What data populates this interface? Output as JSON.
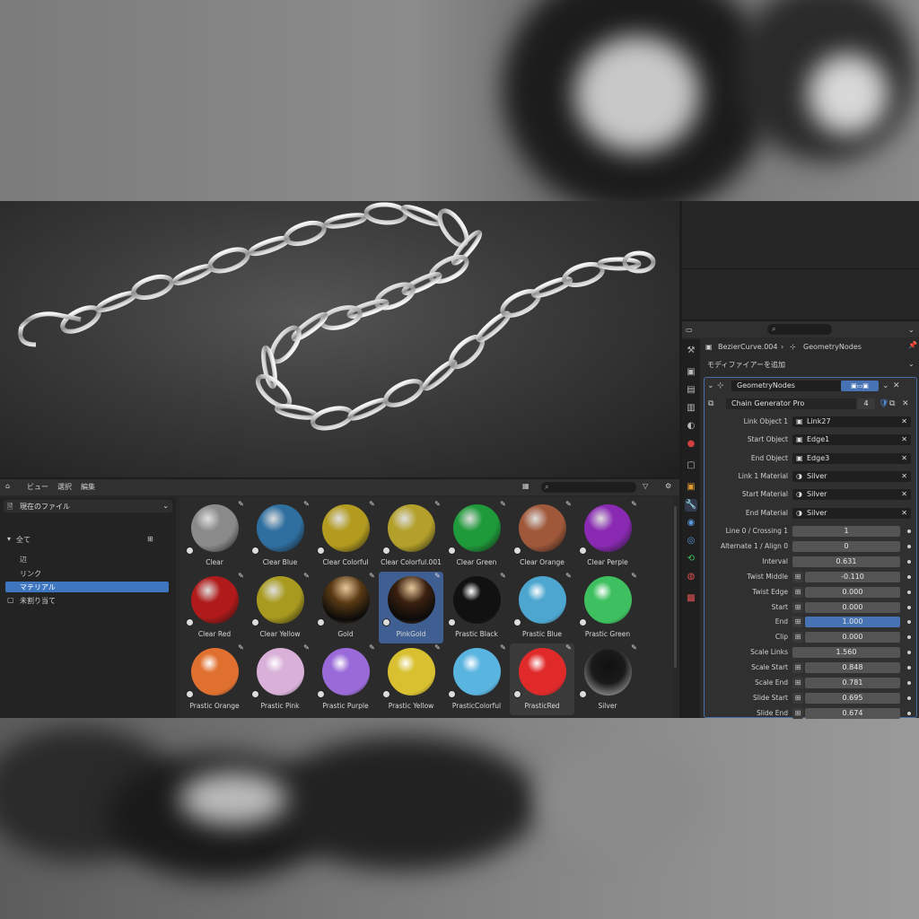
{
  "asset_browser": {
    "header_menus": [
      "ビュー",
      "選択",
      "編集"
    ],
    "search_placeholder": "",
    "catalog_select": "現在のファイル",
    "tree": {
      "all": "全て",
      "items": [
        "辺",
        "リンク",
        "マテリアル"
      ],
      "selected_index": 2,
      "unassigned": "未割り当て"
    },
    "materials": [
      {
        "name": "Clear",
        "color": "#8a8a8a",
        "style": "glass"
      },
      {
        "name": "Clear Blue",
        "color": "#2f6fa0",
        "style": "glass"
      },
      {
        "name": "Clear Colorful",
        "color": "#b39b1f",
        "style": "glass"
      },
      {
        "name": "Clear Colorful.001",
        "color": "#b3a02a",
        "style": "glass"
      },
      {
        "name": "Clear Green",
        "color": "#1f9a3a",
        "style": "glass"
      },
      {
        "name": "Clear Orange",
        "color": "#a0583a",
        "style": "glass"
      },
      {
        "name": "Clear Perple",
        "color": "#8a2ab3",
        "style": "glass"
      },
      {
        "name": "Clear Red",
        "color": "#b01a1a",
        "style": "glass"
      },
      {
        "name": "Clear Yellow",
        "color": "#a89a1f",
        "style": "glass"
      },
      {
        "name": "Gold",
        "color": "#5a3a14",
        "style": "metal"
      },
      {
        "name": "PinkGold",
        "color": "#3a2010",
        "style": "metal"
      },
      {
        "name": "Prastic Black",
        "color": "#111111",
        "style": "plastic"
      },
      {
        "name": "Prastic Blue",
        "color": "#4da6d0",
        "style": "plastic"
      },
      {
        "name": "Prastic Green",
        "color": "#3fc060",
        "style": "plastic"
      },
      {
        "name": "Prastic Orange",
        "color": "#e07030",
        "style": "plastic"
      },
      {
        "name": "Prastic Pink",
        "color": "#d8b0d8",
        "style": "plastic"
      },
      {
        "name": "Prastic Purple",
        "color": "#9a6ad8",
        "style": "plastic"
      },
      {
        "name": "Prastic Yellow",
        "color": "#d8c030",
        "style": "plastic"
      },
      {
        "name": "PrasticColorful",
        "color": "#5ab4e0",
        "style": "plastic"
      },
      {
        "name": "PrasticRed",
        "color": "#e02a2a",
        "style": "plastic"
      },
      {
        "name": "Silver",
        "color": "#2a2a2a",
        "style": "metal"
      }
    ],
    "selected_material": "PinkGold",
    "hovered_material": "PrasticRed"
  },
  "properties": {
    "breadcrumb_object": "BezierCurve.004",
    "breadcrumb_modifier": "GeometryNodes",
    "add_modifier": "モディファイアーを追加",
    "modifier_name": "GeometryNodes",
    "node_group": "Chain Generator Pro",
    "node_group_users": "4",
    "object_rows": [
      {
        "label": "Link Object 1",
        "value": "Link27"
      },
      {
        "label": "Start Object",
        "value": "Edge1"
      },
      {
        "label": "End Object",
        "value": "Edge3"
      },
      {
        "label": "Link 1 Material",
        "value": "Silver"
      },
      {
        "label": "Start Material",
        "value": "Silver"
      },
      {
        "label": "End Material",
        "value": "Silver"
      }
    ],
    "number_rows": [
      {
        "label": "Line 0 / Crossing 1",
        "value": "1",
        "attr": false,
        "highlight": false
      },
      {
        "label": "Alternate 1 / Align 0",
        "value": "0",
        "attr": false,
        "highlight": false
      },
      {
        "label": "Interval",
        "value": "0.631",
        "attr": false,
        "highlight": false
      },
      {
        "label": "Twist Middle",
        "value": "-0.110",
        "attr": true,
        "highlight": false
      },
      {
        "label": "Twist Edge",
        "value": "0.000",
        "attr": true,
        "highlight": false
      },
      {
        "label": "Start",
        "value": "0.000",
        "attr": true,
        "highlight": false
      },
      {
        "label": "End",
        "value": "1.000",
        "attr": true,
        "highlight": true
      },
      {
        "label": "Clip",
        "value": "0.000",
        "attr": true,
        "highlight": false
      },
      {
        "label": "Scale Links",
        "value": "1.560",
        "attr": false,
        "highlight": false
      },
      {
        "label": "Scale Start",
        "value": "0.848",
        "attr": true,
        "highlight": false
      },
      {
        "label": "Scale End",
        "value": "0.781",
        "attr": true,
        "highlight": false
      },
      {
        "label": "Slide Start",
        "value": "0.695",
        "attr": true,
        "highlight": false
      },
      {
        "label": "Slide End",
        "value": "0.674",
        "attr": true,
        "highlight": false
      }
    ]
  },
  "colors": {
    "accent": "#4772b3",
    "selection": "#3f76c0",
    "panel": "#2a2a2a"
  }
}
